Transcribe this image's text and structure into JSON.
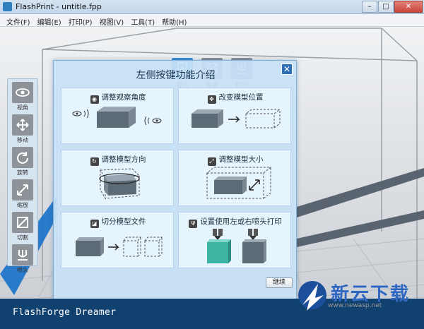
{
  "window": {
    "title": "FlashPrint - untitle.fpp",
    "min": "–",
    "max": "□",
    "close": "✕"
  },
  "menu": [
    "文件(F)",
    "编辑(E)",
    "打印(P)",
    "视图(V)",
    "工具(T)",
    "帮助(H)"
  ],
  "toolbar": [
    {
      "label": "载入",
      "icon": "load-icon"
    },
    {
      "label": "支撑",
      "icon": "support-icon"
    },
    {
      "label": "打印",
      "icon": "print-icon"
    }
  ],
  "lefttools": [
    {
      "label": "视角",
      "icon": "eye-icon"
    },
    {
      "label": "移动",
      "icon": "move-icon"
    },
    {
      "label": "旋转",
      "icon": "rotate-icon"
    },
    {
      "label": "缩放",
      "icon": "scale-icon"
    },
    {
      "label": "切割",
      "icon": "cut-icon"
    },
    {
      "label": "喷头",
      "icon": "nozzle-icon"
    }
  ],
  "dialog": {
    "title": "左侧按键功能介绍",
    "close": "✕",
    "cards": [
      {
        "title": "调整观察角度",
        "icon": "eye-icon"
      },
      {
        "title": "改变模型位置",
        "icon": "move-icon"
      },
      {
        "title": "调整模型方向",
        "icon": "rotate-icon"
      },
      {
        "title": "调整模型大小",
        "icon": "scale-icon"
      },
      {
        "title": "切分模型文件",
        "icon": "cut-icon"
      },
      {
        "title": "设置使用左或右喷头打印",
        "icon": "nozzle-icon"
      }
    ],
    "next": "继续"
  },
  "brand": "FlashForge Dreamer",
  "watermark": {
    "text": "新云下载",
    "sub": "www.newasp.net"
  }
}
